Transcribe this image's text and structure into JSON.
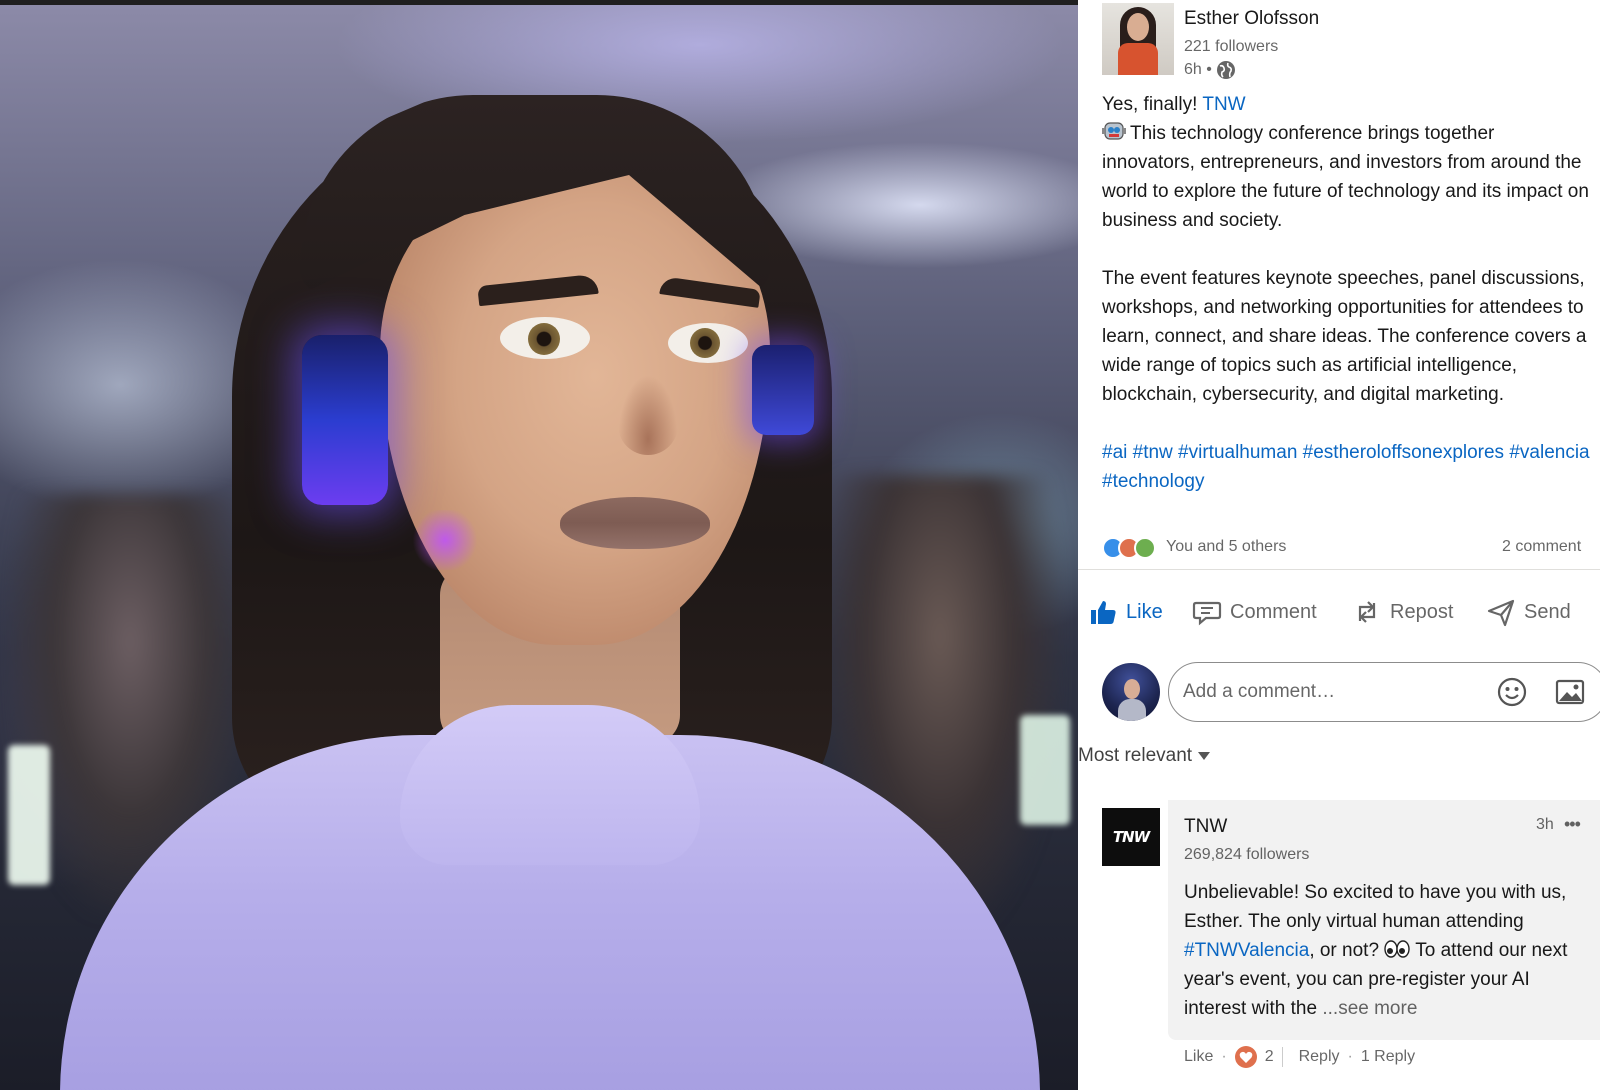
{
  "author": {
    "name": "Esther Olofsson",
    "followers": "221 followers",
    "time": "6h •",
    "visibility_icon": "globe-icon"
  },
  "post": {
    "intro": "Yes, finally! ",
    "mention": "TNW",
    "para1": "This technology conference brings together innovators, entrepreneurs, and investors from around the world to explore the future of technology and its impact on business and society.",
    "para2": "The event features keynote speeches, panel discussions, workshops, and networking opportunities for attendees to learn, connect, and share ideas. The conference covers a wide range of topics such as artificial intelligence, blockchain, cybersecurity, and digital marketing.",
    "hashtags": "#ai #tnw #virtualhuman #estheroloffsonexplores #valencia #technology"
  },
  "social": {
    "reactions_text": "You and 5 others",
    "comments_text": "2 comment"
  },
  "actions": {
    "like": "Like",
    "comment": "Comment",
    "repost": "Repost",
    "send": "Send"
  },
  "comment_box": {
    "placeholder": "Add a comment…"
  },
  "sort": {
    "label": "Most relevant"
  },
  "comments": [
    {
      "name": "TNW",
      "logo_text": "TNW",
      "followers": "269,824 followers",
      "time": "3h",
      "more": "•••",
      "text_before": "Unbelievable! So excited to have you with us, Esther. The only virtual human attending ",
      "hashtag": "#TNWValencia",
      "text_mid": ", or not? ",
      "text_after": " To attend our next year's event, you can pre-register your AI interest with the",
      "see_more": " ...see more",
      "like": "Like",
      "love_count": "2",
      "reply": "Reply",
      "reply_count": "1 Reply"
    }
  ],
  "colors": {
    "brand_blue": "#0a66c2",
    "like_reaction": "#378fe9",
    "love_reaction": "#df704d",
    "celebrate_reaction": "#6dae4f"
  }
}
